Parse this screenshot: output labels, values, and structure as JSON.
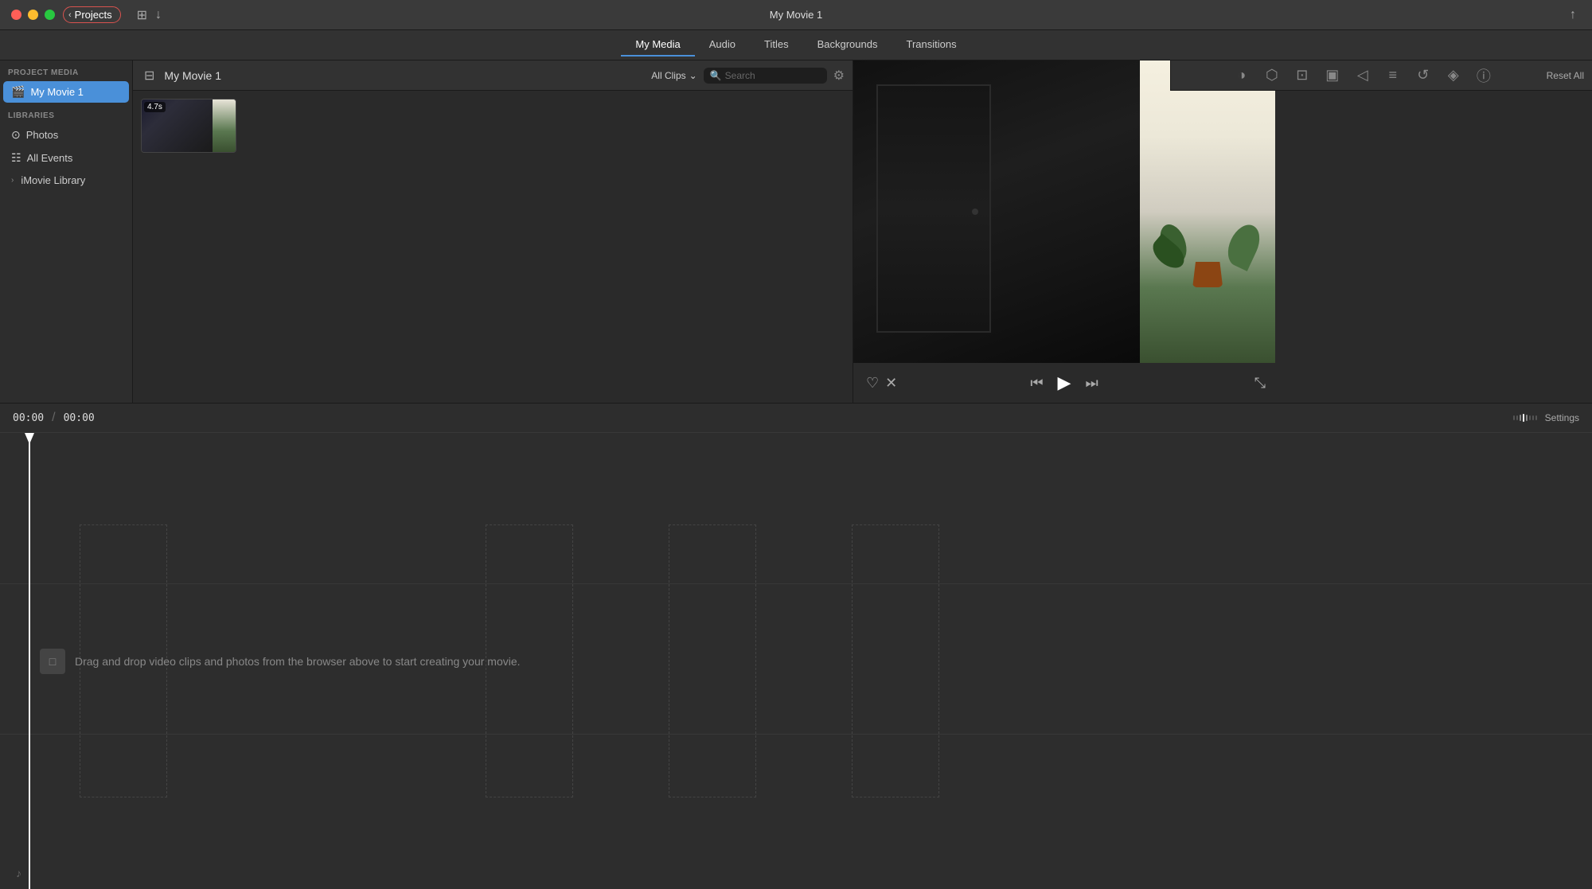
{
  "window": {
    "title": "My Movie 1"
  },
  "titlebar": {
    "projects_label": "Projects",
    "download_icon": "↓"
  },
  "navbar": {
    "tabs": [
      {
        "id": "my-media",
        "label": "My Media",
        "active": true
      },
      {
        "id": "audio",
        "label": "Audio",
        "active": false
      },
      {
        "id": "titles",
        "label": "Titles",
        "active": false
      },
      {
        "id": "backgrounds",
        "label": "Backgrounds",
        "active": false
      },
      {
        "id": "transitions",
        "label": "Transitions",
        "active": false
      }
    ]
  },
  "sidebar": {
    "project_media_label": "PROJECT MEDIA",
    "project_item": "My Movie 1",
    "libraries_label": "LIBRARIES",
    "library_items": [
      {
        "id": "photos",
        "label": "Photos",
        "icon": "⊙"
      },
      {
        "id": "all-events",
        "label": "All Events",
        "icon": "☷"
      },
      {
        "id": "imovie-library",
        "label": "iMovie Library",
        "icon": ""
      }
    ]
  },
  "browser": {
    "title": "My Movie 1",
    "filter_label": "All Clips",
    "search_placeholder": "Search",
    "clips": [
      {
        "id": "clip1",
        "duration": "4.7s"
      }
    ]
  },
  "preview": {
    "timecode_current": "00:00",
    "timecode_total": "00:00"
  },
  "timeline": {
    "settings_label": "Settings",
    "drop_hint": "Drag and drop video clips and photos from the browser above to start creating your movie.",
    "drop_icon": "□"
  },
  "toolbar_tools": [
    {
      "id": "color-balance",
      "icon": "◑",
      "title": "Color Balance"
    },
    {
      "id": "color-correction",
      "icon": "⬡",
      "title": "Color Correction"
    },
    {
      "id": "crop",
      "icon": "⊡",
      "title": "Crop"
    },
    {
      "id": "camera",
      "icon": "▣",
      "title": "Camera"
    },
    {
      "id": "volume",
      "icon": "◁",
      "title": "Volume"
    },
    {
      "id": "equalizer",
      "icon": "≡",
      "title": "Equalizer"
    },
    {
      "id": "speed",
      "icon": "↺",
      "title": "Speed"
    },
    {
      "id": "noise",
      "icon": "◈",
      "title": "Noise Reduction"
    },
    {
      "id": "info",
      "icon": "ⓘ",
      "title": "Info"
    }
  ],
  "reset_all_label": "Reset All"
}
